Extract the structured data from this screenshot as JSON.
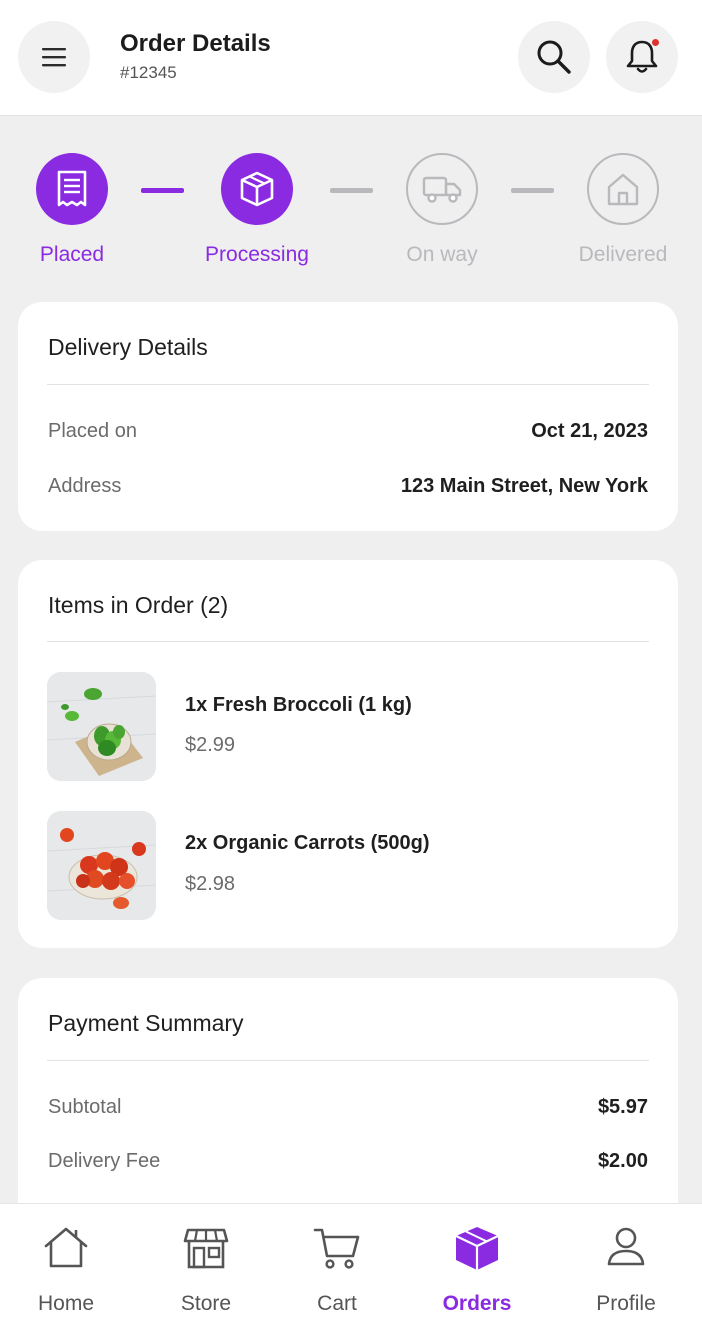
{
  "header": {
    "title": "Order Details",
    "order_number": "#12345",
    "menu_icon": "menu-icon",
    "search_icon": "search-icon",
    "bell_icon": "bell-icon"
  },
  "colors": {
    "accent": "#8a2be2",
    "inactive": "#b9b9bd",
    "notification_dot": "#e0312f",
    "background": "#efefef"
  },
  "stepper": {
    "steps": [
      {
        "label": "Placed",
        "icon": "receipt-icon",
        "state": "done"
      },
      {
        "label": "Processing",
        "icon": "box-icon",
        "state": "done"
      },
      {
        "label": "On way",
        "icon": "truck-icon",
        "state": "pending"
      },
      {
        "label": "Delivered",
        "icon": "home-icon",
        "state": "pending"
      }
    ]
  },
  "delivery": {
    "title": "Delivery Details",
    "rows": [
      {
        "label": "Placed on",
        "value": "Oct 21, 2023"
      },
      {
        "label": "Address",
        "value": "123 Main Street, New York"
      }
    ]
  },
  "items": {
    "title": "Items in Order (2)",
    "list": [
      {
        "name": "1x Fresh Broccoli (1 kg)",
        "price": "$2.99",
        "image": "green-peppers-image"
      },
      {
        "name": "2x Organic Carrots (500g)",
        "price": "$2.98",
        "image": "tomatoes-image"
      }
    ]
  },
  "payment": {
    "title": "Payment Summary",
    "rows": [
      {
        "label": "Subtotal",
        "value": "$5.97"
      },
      {
        "label": "Delivery Fee",
        "value": "$2.00"
      }
    ]
  },
  "nav": {
    "items": [
      {
        "label": "Home",
        "icon": "home-icon",
        "active": false
      },
      {
        "label": "Store",
        "icon": "store-icon",
        "active": false
      },
      {
        "label": "Cart",
        "icon": "cart-icon",
        "active": false
      },
      {
        "label": "Orders",
        "icon": "box-icon",
        "active": true
      },
      {
        "label": "Profile",
        "icon": "user-icon",
        "active": false
      }
    ]
  }
}
